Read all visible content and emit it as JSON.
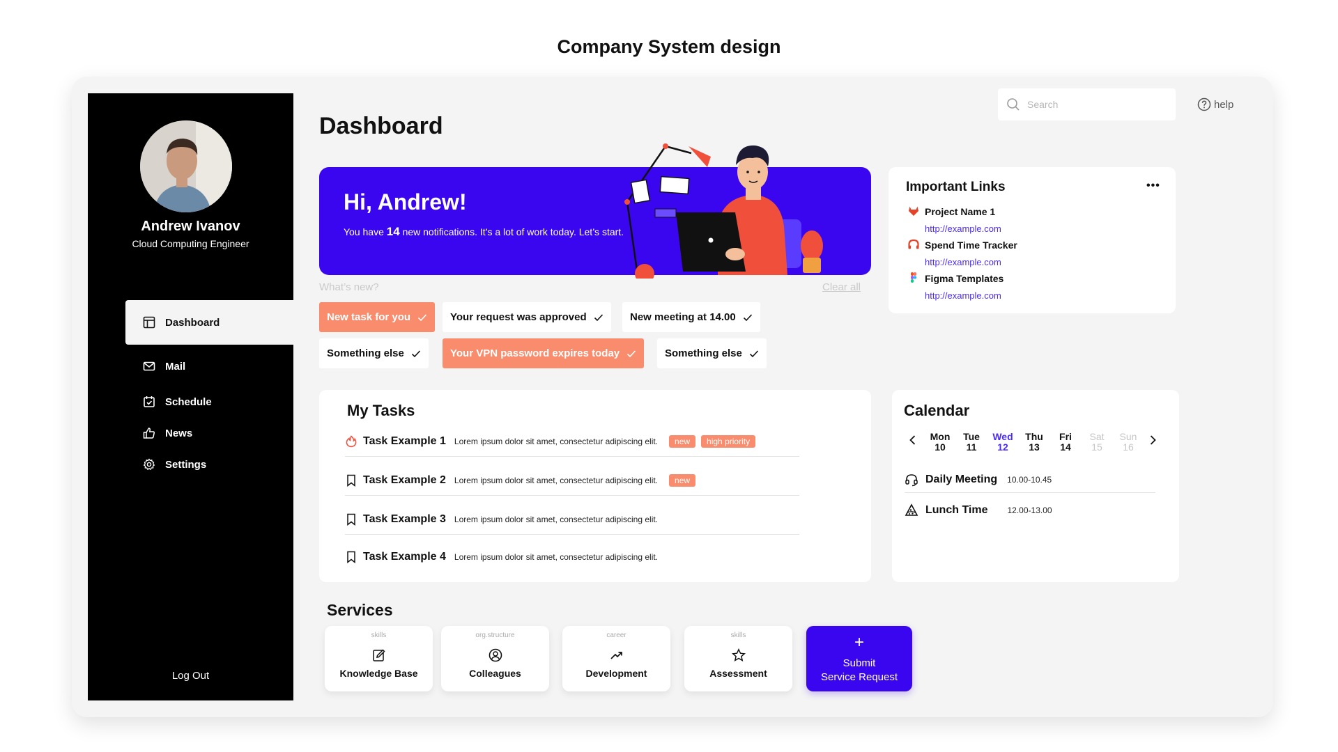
{
  "page": {
    "title": "Company System design"
  },
  "sidebar": {
    "user_name": "Andrew Ivanov",
    "user_role": "Cloud Computing Engineer",
    "items": [
      {
        "label": "Dashboard",
        "icon": "layout-icon",
        "active": true
      },
      {
        "label": "Mail",
        "icon": "mail-icon"
      },
      {
        "label": "Schedule",
        "icon": "calendar-check-icon"
      },
      {
        "label": "News",
        "icon": "thumbs-up-icon"
      },
      {
        "label": "Settings",
        "icon": "gear-icon"
      }
    ],
    "logout_label": "Log Out"
  },
  "header": {
    "title": "Dashboard",
    "search_placeholder": "Search",
    "help_label": "help"
  },
  "banner": {
    "greeting": "Hi, Andrew!",
    "text_before": "You have ",
    "count": "14",
    "text_after": " new notifications. It’s a lot of work today. Let’s start."
  },
  "notifications": {
    "heading": "What’s new?",
    "clear_label": "Clear all",
    "chips": [
      {
        "label": "New task for you",
        "highlight": true
      },
      {
        "label": "Your request was approved",
        "highlight": false
      },
      {
        "label": "New meeting at 14.00",
        "highlight": false
      },
      {
        "label": "Something else",
        "highlight": false
      },
      {
        "label": "Your VPN password expires today",
        "highlight": true
      },
      {
        "label": "Something else",
        "highlight": false
      }
    ],
    "highlight_color": "#f88c6c"
  },
  "links": {
    "title": "Important Links",
    "items": [
      {
        "name": "Project Name 1",
        "url": "http://example.com",
        "icon": "gitlab-icon"
      },
      {
        "name": "Spend Time Tracker",
        "url": "http://example.com",
        "icon": "headphones-icon"
      },
      {
        "name": "Figma Templates",
        "url": "http://example.com",
        "icon": "figma-icon"
      }
    ]
  },
  "tasks": {
    "title": "My Tasks",
    "items": [
      {
        "title": "Task Example 1",
        "desc": "Lorem ipsum dolor sit amet, consectetur adipiscing elit.",
        "tags": [
          "new",
          "high priority"
        ],
        "icon": "fire-icon"
      },
      {
        "title": "Task Example 2",
        "desc": "Lorem ipsum dolor sit amet, consectetur adipiscing elit.",
        "tags": [
          "new"
        ],
        "icon": "bookmark-icon"
      },
      {
        "title": "Task Example 3",
        "desc": "Lorem ipsum dolor sit amet, consectetur adipiscing elit.",
        "tags": [],
        "icon": "bookmark-icon"
      },
      {
        "title": "Task Example 4",
        "desc": "Lorem ipsum dolor sit amet, consectetur adipiscing elit.",
        "tags": [],
        "icon": "bookmark-icon"
      }
    ]
  },
  "calendar": {
    "title": "Calendar",
    "days": [
      {
        "name": "Mon",
        "num": "10"
      },
      {
        "name": "Tue",
        "num": "11"
      },
      {
        "name": "Wed",
        "num": "12",
        "active": true
      },
      {
        "name": "Thu",
        "num": "13"
      },
      {
        "name": "Fri",
        "num": "14"
      },
      {
        "name": "Sat",
        "num": "15",
        "weekend": true
      },
      {
        "name": "Sun",
        "num": "16",
        "weekend": true
      }
    ],
    "events": [
      {
        "name": "Daily Meeting",
        "time": "10.00-10.45",
        "icon": "headset-icon"
      },
      {
        "name": "Lunch Time",
        "time": "12.00-13.00",
        "icon": "pizza-icon"
      }
    ],
    "accent": "#4b2cf5"
  },
  "services": {
    "title": "Services",
    "items": [
      {
        "category": "skills",
        "name": "Knowledge Base",
        "icon": "edit-icon"
      },
      {
        "category": "org.structure",
        "name": "Colleagues",
        "icon": "user-circle-icon"
      },
      {
        "category": "career",
        "name": "Development",
        "icon": "trending-up-icon"
      },
      {
        "category": "skills",
        "name": "Assessment",
        "icon": "star-icon"
      }
    ],
    "submit_plus": "+",
    "submit_line1": "Submit",
    "submit_line2": "Service Request",
    "brand_color": "#3a06f0"
  }
}
